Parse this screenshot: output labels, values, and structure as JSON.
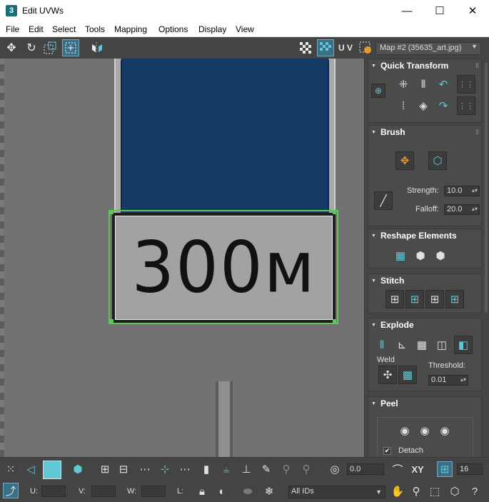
{
  "window": {
    "app_icon": "3",
    "title": "Edit UVWs",
    "minimize": "—",
    "maximize": "☐",
    "close": "✕"
  },
  "menu": {
    "items": [
      "File",
      "Edit",
      "Select",
      "Tools",
      "Mapping",
      "Options",
      "Display",
      "View"
    ]
  },
  "toolbar": {
    "uv_label": "U V",
    "map_select": "Map #2 (35635_art.jpg)"
  },
  "viewport": {
    "sign_text": "300м"
  },
  "panel": {
    "quick_transform": "Quick Transform",
    "brush": "Brush",
    "strength_label": "Strength:",
    "strength_value": "10.0",
    "falloff_label": "Falloff:",
    "falloff_value": "20.0",
    "reshape": "Reshape Elements",
    "stitch": "Stitch",
    "explode": "Explode",
    "weld_label": "Weld",
    "threshold_label": "Threshold:",
    "threshold_value": "0.01",
    "peel": "Peel",
    "detach_label": "Detach",
    "detach_checked": true
  },
  "bottom": {
    "angle_value": "0.0",
    "xy_label": "XY",
    "snap_value": "16",
    "u_label": "U:",
    "v_label": "V:",
    "w_label": "W:",
    "l_label": "L:",
    "ids_value": "All IDs"
  },
  "colors": {
    "accent": "#5fc8d4",
    "selection": "#5ec75a",
    "blue_sign": "#163a66"
  }
}
